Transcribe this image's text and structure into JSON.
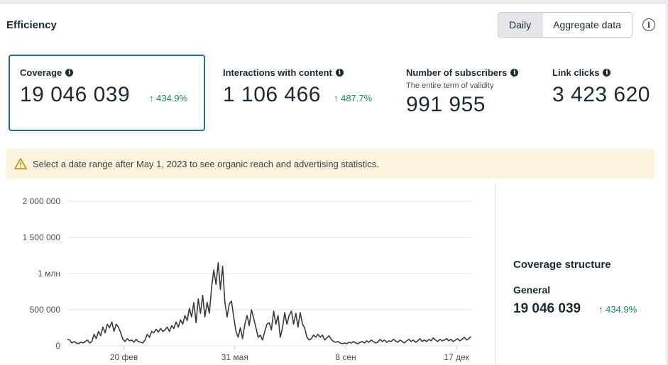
{
  "header": {
    "title": "Efficiency"
  },
  "toggle": {
    "daily": "Daily",
    "aggregate": "Aggregate data"
  },
  "info_icon": "i",
  "metrics": [
    {
      "label": "Coverage",
      "value": "19 046 039",
      "delta": "↑ 434.9%"
    },
    {
      "label": "Interactions with content",
      "value": "1 106 466",
      "delta": "↑ 487.7%"
    },
    {
      "label": "Number of subscribers",
      "subtitle": "The entire term of validity",
      "value": "991 955"
    },
    {
      "label": "Link clicks",
      "value": "3 423 620"
    }
  ],
  "warning": {
    "text": "Select a date range after May 1, 2023 to see organic reach and advertising statistics."
  },
  "structure": {
    "title": "Coverage structure",
    "label": "General",
    "value": "19 046 039",
    "delta": "↑ 434.9%"
  },
  "colors": {
    "accent": "#2d6e8e",
    "positive": "#1f8a53",
    "warning_bg": "#fcf3de",
    "line": "#3a3a3a"
  },
  "chart_data": {
    "type": "line",
    "y_ticks": [
      {
        "value": 0,
        "label": "0"
      },
      {
        "value": 500000,
        "label": "500 000"
      },
      {
        "value": 1000000,
        "label": "1 млн"
      },
      {
        "value": 1500000,
        "label": "1 500 000"
      },
      {
        "value": 2000000,
        "label": "2 000 000"
      }
    ],
    "x_ticks": [
      {
        "day": 51,
        "label": "20 фев"
      },
      {
        "day": 151,
        "label": "31 мая"
      },
      {
        "day": 251,
        "label": "8 сен"
      },
      {
        "day": 351,
        "label": "17 дек"
      }
    ],
    "ylim": [
      0,
      2000000
    ],
    "xlim": [
      0,
      365
    ],
    "grid": true,
    "series": [
      {
        "points": [
          [
            0,
            90000
          ],
          [
            2,
            80000
          ],
          [
            4,
            40000
          ],
          [
            6,
            60000
          ],
          [
            8,
            40000
          ],
          [
            10,
            30000
          ],
          [
            12,
            50000
          ],
          [
            14,
            40000
          ],
          [
            16,
            60000
          ],
          [
            18,
            80000
          ],
          [
            20,
            40000
          ],
          [
            22,
            60000
          ],
          [
            24,
            160000
          ],
          [
            26,
            100000
          ],
          [
            28,
            200000
          ],
          [
            30,
            140000
          ],
          [
            32,
            260000
          ],
          [
            34,
            180000
          ],
          [
            36,
            300000
          ],
          [
            38,
            250000
          ],
          [
            40,
            330000
          ],
          [
            42,
            200000
          ],
          [
            44,
            300000
          ],
          [
            46,
            260000
          ],
          [
            48,
            180000
          ],
          [
            50,
            90000
          ],
          [
            52,
            60000
          ],
          [
            54,
            100000
          ],
          [
            56,
            70000
          ],
          [
            58,
            80000
          ],
          [
            60,
            50000
          ],
          [
            62,
            90000
          ],
          [
            64,
            60000
          ],
          [
            66,
            50000
          ],
          [
            68,
            40000
          ],
          [
            70,
            80000
          ],
          [
            72,
            160000
          ],
          [
            74,
            120000
          ],
          [
            76,
            200000
          ],
          [
            78,
            180000
          ],
          [
            80,
            230000
          ],
          [
            82,
            190000
          ],
          [
            84,
            240000
          ],
          [
            86,
            200000
          ],
          [
            88,
            220000
          ],
          [
            90,
            260000
          ],
          [
            92,
            200000
          ],
          [
            94,
            280000
          ],
          [
            96,
            240000
          ],
          [
            98,
            330000
          ],
          [
            100,
            260000
          ],
          [
            102,
            360000
          ],
          [
            104,
            300000
          ],
          [
            106,
            420000
          ],
          [
            108,
            350000
          ],
          [
            110,
            520000
          ],
          [
            112,
            400000
          ],
          [
            114,
            600000
          ],
          [
            116,
            320000
          ],
          [
            118,
            650000
          ],
          [
            120,
            450000
          ],
          [
            122,
            700000
          ],
          [
            124,
            400000
          ],
          [
            126,
            600000
          ],
          [
            128,
            450000
          ],
          [
            130,
            800000
          ],
          [
            132,
            1050000
          ],
          [
            134,
            850000
          ],
          [
            136,
            1150000
          ],
          [
            138,
            780000
          ],
          [
            140,
            1100000
          ],
          [
            142,
            600000
          ],
          [
            144,
            400000
          ],
          [
            146,
            580000
          ],
          [
            148,
            620000
          ],
          [
            150,
            400000
          ],
          [
            152,
            200000
          ],
          [
            154,
            120000
          ],
          [
            156,
            250000
          ],
          [
            158,
            100000
          ],
          [
            160,
            300000
          ],
          [
            162,
            420000
          ],
          [
            164,
            280000
          ],
          [
            166,
            500000
          ],
          [
            168,
            380000
          ],
          [
            170,
            250000
          ],
          [
            172,
            120000
          ],
          [
            174,
            150000
          ],
          [
            176,
            80000
          ],
          [
            178,
            200000
          ],
          [
            180,
            300000
          ],
          [
            182,
            320000
          ],
          [
            184,
            220000
          ],
          [
            186,
            480000
          ],
          [
            188,
            300000
          ],
          [
            190,
            420000
          ],
          [
            192,
            120000
          ],
          [
            194,
            250000
          ],
          [
            196,
            460000
          ],
          [
            198,
            300000
          ],
          [
            200,
            420000
          ],
          [
            202,
            480000
          ],
          [
            204,
            300000
          ],
          [
            206,
            450000
          ],
          [
            208,
            260000
          ],
          [
            210,
            460000
          ],
          [
            212,
            300000
          ],
          [
            214,
            250000
          ],
          [
            216,
            120000
          ],
          [
            218,
            80000
          ],
          [
            220,
            100000
          ],
          [
            222,
            150000
          ],
          [
            224,
            120000
          ],
          [
            226,
            160000
          ],
          [
            228,
            120000
          ],
          [
            230,
            150000
          ],
          [
            232,
            80000
          ],
          [
            234,
            110000
          ],
          [
            236,
            140000
          ],
          [
            238,
            90000
          ],
          [
            240,
            60000
          ],
          [
            242,
            50000
          ],
          [
            244,
            60000
          ],
          [
            246,
            40000
          ],
          [
            248,
            30000
          ],
          [
            250,
            40000
          ],
          [
            252,
            30000
          ],
          [
            254,
            50000
          ],
          [
            256,
            40000
          ],
          [
            258,
            60000
          ],
          [
            260,
            40000
          ],
          [
            262,
            30000
          ],
          [
            264,
            50000
          ],
          [
            266,
            60000
          ],
          [
            268,
            40000
          ],
          [
            270,
            70000
          ],
          [
            272,
            50000
          ],
          [
            274,
            80000
          ],
          [
            276,
            60000
          ],
          [
            278,
            40000
          ],
          [
            280,
            50000
          ],
          [
            282,
            90000
          ],
          [
            284,
            60000
          ],
          [
            286,
            80000
          ],
          [
            288,
            50000
          ],
          [
            290,
            70000
          ],
          [
            292,
            60000
          ],
          [
            294,
            90000
          ],
          [
            296,
            70000
          ],
          [
            298,
            50000
          ],
          [
            300,
            80000
          ],
          [
            302,
            60000
          ],
          [
            304,
            40000
          ],
          [
            306,
            70000
          ],
          [
            308,
            90000
          ],
          [
            310,
            60000
          ],
          [
            312,
            80000
          ],
          [
            314,
            50000
          ],
          [
            316,
            70000
          ],
          [
            318,
            100000
          ],
          [
            320,
            60000
          ],
          [
            322,
            80000
          ],
          [
            324,
            60000
          ],
          [
            326,
            90000
          ],
          [
            328,
            70000
          ],
          [
            330,
            110000
          ],
          [
            332,
            80000
          ],
          [
            334,
            60000
          ],
          [
            336,
            90000
          ],
          [
            338,
            70000
          ],
          [
            340,
            80000
          ],
          [
            342,
            100000
          ],
          [
            344,
            70000
          ],
          [
            346,
            90000
          ],
          [
            348,
            60000
          ],
          [
            350,
            80000
          ],
          [
            352,
            100000
          ],
          [
            354,
            70000
          ],
          [
            356,
            90000
          ],
          [
            358,
            120000
          ],
          [
            360,
            80000
          ],
          [
            362,
            100000
          ],
          [
            364,
            130000
          ]
        ]
      }
    ]
  }
}
